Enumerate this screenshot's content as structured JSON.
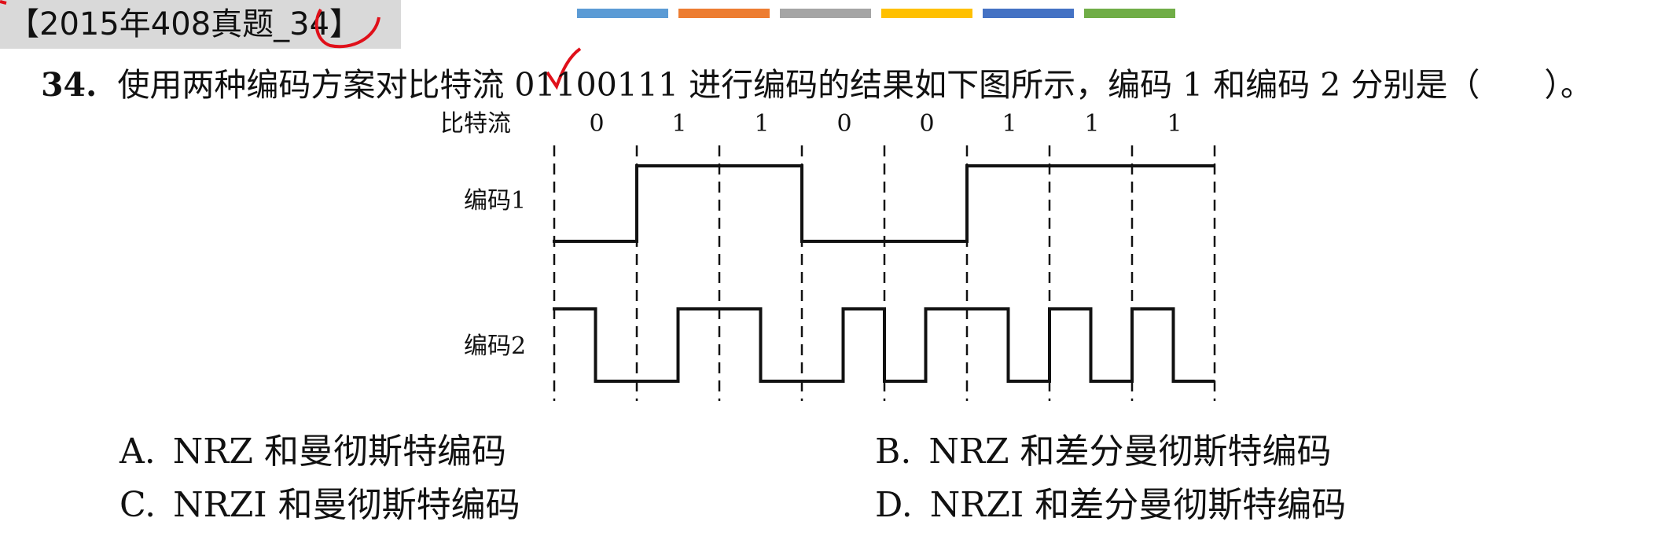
{
  "header": {
    "tag": "【2015年408真题_34】",
    "palette": [
      "#5b9bd5",
      "#ed7d31",
      "#a5a5a5",
      "#ffc000",
      "#4472c4",
      "#70ad47"
    ]
  },
  "question": {
    "number": "34.",
    "text": "使用两种编码方案对比特流 01100111 进行编码的结果如下图所示，编码 1 和编码 2 分别是（　　）。"
  },
  "figure": {
    "bitstream_label": "比特流",
    "bits": [
      "0",
      "1",
      "1",
      "0",
      "0",
      "1",
      "1",
      "1"
    ],
    "code1_label": "编码1",
    "code2_label": "编码2",
    "code1_levels": [
      0,
      1,
      1,
      0,
      0,
      1,
      1,
      1
    ],
    "code2_halves": [
      [
        1,
        0
      ],
      [
        0,
        1
      ],
      [
        1,
        0
      ],
      [
        0,
        1
      ],
      [
        0,
        1
      ],
      [
        1,
        0
      ],
      [
        1,
        0
      ],
      [
        1,
        0
      ]
    ]
  },
  "options": [
    {
      "letter": "A.",
      "text": "NRZ 和曼彻斯特编码"
    },
    {
      "letter": "B.",
      "text": "NRZ 和差分曼彻斯特编码"
    },
    {
      "letter": "C.",
      "text": "NRZI 和曼彻斯特编码"
    },
    {
      "letter": "D.",
      "text": "NRZI 和差分曼彻斯特编码"
    }
  ]
}
